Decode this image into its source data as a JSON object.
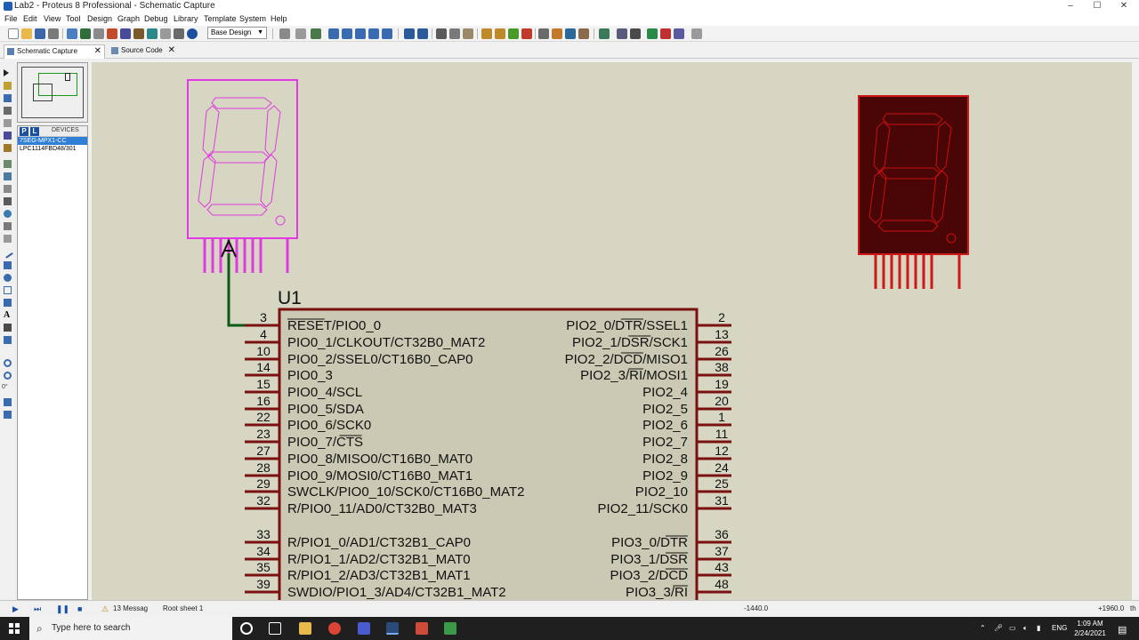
{
  "window": {
    "title": "Lab2 - Proteus 8 Professional - Schematic Capture",
    "min": "–",
    "max": "☐",
    "close": "✕"
  },
  "menu": [
    "File",
    "Edit",
    "View",
    "Tool",
    "Design",
    "Graph",
    "Debug",
    "Library",
    "Template",
    "System",
    "Help"
  ],
  "toolbar": {
    "design_select": "Base Design"
  },
  "tabs": [
    {
      "label": "Schematic Capture",
      "close": "✕"
    },
    {
      "label": "Source Code",
      "close": "✕"
    }
  ],
  "sidebar": {
    "p_label": "P",
    "l_label": "L",
    "devices_label": "DEVICES",
    "devices": [
      "7SEG-MPX1-CC",
      "LPC1114FBD48/301"
    ],
    "rotation_readout": "0°"
  },
  "schematic": {
    "ref": "U1",
    "left_pins": [
      {
        "num": "3",
        "name": "RESET/PIO0_0",
        "overbar": "RESET"
      },
      {
        "num": "4",
        "name": "PIO0_1/CLKOUT/CT32B0_MAT2"
      },
      {
        "num": "10",
        "name": "PIO0_2/SSEL0/CT16B0_CAP0"
      },
      {
        "num": "14",
        "name": "PIO0_3"
      },
      {
        "num": "15",
        "name": "PIO0_4/SCL"
      },
      {
        "num": "16",
        "name": "PIO0_5/SDA"
      },
      {
        "num": "22",
        "name": "PIO0_6/SCK0"
      },
      {
        "num": "23",
        "name": "PIO0_7/CTS",
        "overbar": "CTS"
      },
      {
        "num": "27",
        "name": "PIO0_8/MISO0/CT16B0_MAT0"
      },
      {
        "num": "28",
        "name": "PIO0_9/MOSI0/CT16B0_MAT1"
      },
      {
        "num": "29",
        "name": "SWCLK/PIO0_10/SCK0/CT16B0_MAT2"
      },
      {
        "num": "32",
        "name": "R/PIO0_11/AD0/CT32B0_MAT3"
      },
      {
        "num": "33",
        "name": "R/PIO1_0/AD1/CT32B1_CAP0"
      },
      {
        "num": "34",
        "name": "R/PIO1_1/AD2/CT32B1_MAT0"
      },
      {
        "num": "35",
        "name": "R/PIO1_2/AD3/CT32B1_MAT1"
      },
      {
        "num": "39",
        "name": "SWDIO/PIO1_3/AD4/CT32B1_MAT2"
      }
    ],
    "right_pins": [
      {
        "num": "2",
        "name": "PIO2_0/DTR/SSEL1",
        "overbar": "DTR"
      },
      {
        "num": "13",
        "name": "PIO2_1/DSR/SCK1",
        "overbar": "DSR"
      },
      {
        "num": "26",
        "name": "PIO2_2/DCD/MISO1",
        "overbar": "DCD"
      },
      {
        "num": "38",
        "name": "PIO2_3/RI/MOSI1",
        "overbar": "RI"
      },
      {
        "num": "19",
        "name": "PIO2_4"
      },
      {
        "num": "20",
        "name": "PIO2_5"
      },
      {
        "num": "1",
        "name": "PIO2_6"
      },
      {
        "num": "11",
        "name": "PIO2_7"
      },
      {
        "num": "12",
        "name": "PIO2_8"
      },
      {
        "num": "24",
        "name": "PIO2_9"
      },
      {
        "num": "25",
        "name": "PIO2_10"
      },
      {
        "num": "31",
        "name": "PIO2_11/SCK0"
      },
      {
        "num": "36",
        "name": "PIO3_0/DTR",
        "overbar": "DTR"
      },
      {
        "num": "37",
        "name": "PIO3_1/DSR",
        "overbar": "DSR"
      },
      {
        "num": "43",
        "name": "PIO3_2/DCD",
        "overbar": "DCD"
      },
      {
        "num": "48",
        "name": "PIO3_3/RI",
        "overbar": "RI"
      }
    ]
  },
  "status": {
    "messages": "13 Messag",
    "sheet": "Root sheet 1",
    "coord_x": "-1440.0",
    "coord_y": "+1960.0",
    "unit": "th"
  },
  "taskbar": {
    "search_placeholder": "Type here to search",
    "lang": "ENG",
    "time": "1:09 AM",
    "date": "2/24/2021"
  },
  "colors": {
    "canvas": "#d6d6c2",
    "chip_border": "#7a1010",
    "chip_fill": "#cbc9b3",
    "seg_magenta": "#e23ae2",
    "seg_red": "#cc1010",
    "wire": "#0a5a14"
  }
}
